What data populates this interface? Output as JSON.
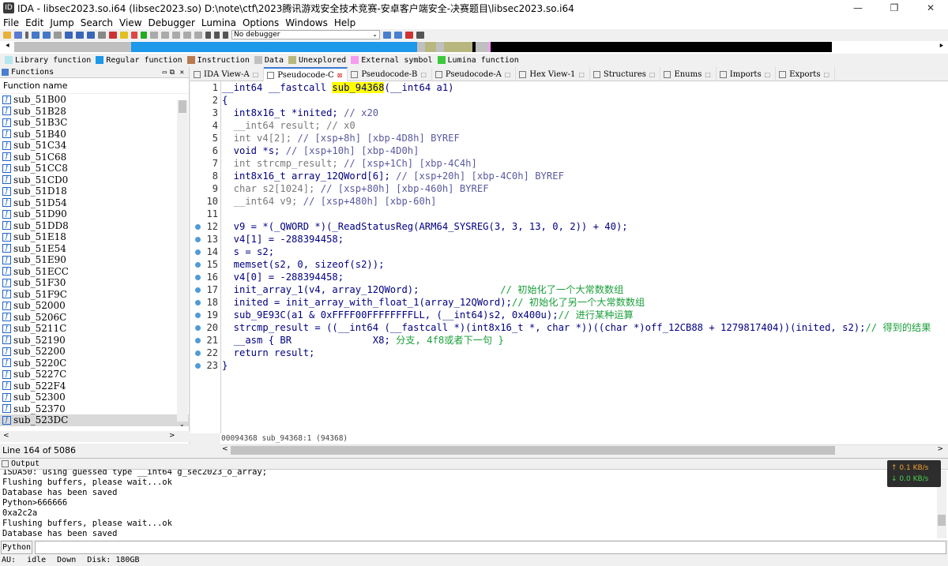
{
  "window": {
    "title": "IDA - libsec2023.so.i64 (libsec2023.so) D:\\note\\ctf\\2023腾讯游戏安全技术竞赛-安卓客户端安全-决赛题目\\libsec2023.so.i64",
    "minimize": "—",
    "maximize": "❐",
    "close": "✕"
  },
  "menu": [
    "File",
    "Edit",
    "Jump",
    "Search",
    "View",
    "Debugger",
    "Lumina",
    "Options",
    "Windows",
    "Help"
  ],
  "toolbar": {
    "debugger": "No debugger"
  },
  "legend": [
    {
      "label": "Library function",
      "color": "#b4e6f0"
    },
    {
      "label": "Regular function",
      "color": "#1e98e8"
    },
    {
      "label": "Instruction",
      "color": "#b87a50"
    },
    {
      "label": "Data",
      "color": "#c0c0c0"
    },
    {
      "label": "Unexplored",
      "color": "#b9b780"
    },
    {
      "label": "External symbol",
      "color": "#f49cf0"
    },
    {
      "label": "Lumina function",
      "color": "#3cc83c"
    }
  ],
  "functions": {
    "title": "Functions",
    "column": "Function name",
    "items": [
      "sub_51B00",
      "sub_51B28",
      "sub_51B3C",
      "sub_51B40",
      "sub_51C34",
      "sub_51C68",
      "sub_51CC8",
      "sub_51CD0",
      "sub_51D18",
      "sub_51D54",
      "sub_51D90",
      "sub_51DD8",
      "sub_51E18",
      "sub_51E54",
      "sub_51E90",
      "sub_51ECC",
      "sub_51F30",
      "sub_51F9C",
      "sub_52000",
      "sub_5206C",
      "sub_5211C",
      "sub_52190",
      "sub_52200",
      "sub_5220C",
      "sub_5227C",
      "sub_522F4",
      "sub_52300",
      "sub_52370",
      "sub_523DC"
    ],
    "line_count": "Line 164 of 5086"
  },
  "tabs": [
    "IDA View-A",
    "Pseudocode-C",
    "Pseudocode-B",
    "Pseudocode-A",
    "Hex View-1",
    "Structures",
    "Enums",
    "Imports",
    "Exports"
  ],
  "code": {
    "line_numbers": [
      "1",
      "2",
      "3",
      "4",
      "5",
      "6",
      "7",
      "8",
      "9",
      "10",
      "11",
      "12",
      "13",
      "14",
      "15",
      "16",
      "17",
      "18",
      "19",
      "20",
      "21",
      "22",
      "23"
    ],
    "l1_pre": "__int64 __fastcall ",
    "l1_fn": "sub_94368",
    "l1_post": "(__int64 a1)",
    "l2": "{",
    "l3a": "  int8x16_t *inited; ",
    "l3b": "// x20",
    "l4": "  __int64 result; // x0",
    "l5a": "  int v4[2]; ",
    "l5b": "// [xsp+8h] [xbp-4D8h] BYREF",
    "l6a": "  void *s; ",
    "l6b": "// [xsp+10h] [xbp-4D0h]",
    "l7a": "  int strcmp_result; ",
    "l7b": "// [xsp+1Ch] [xbp-4C4h]",
    "l8a": "  int8x16_t array_12QWord[6]; ",
    "l8b": "// [xsp+20h] [xbp-4C0h] BYREF",
    "l9a": "  char s2[1024]; ",
    "l9b": "// [xsp+80h] [xbp-460h] BYREF",
    "l10a": "  __int64 v9; ",
    "l10b": "// [xsp+480h] [xbp-60h]",
    "l11": "",
    "l12": "  v9 = *(_QWORD *)(_ReadStatusReg(ARM64_SYSREG(3, 3, 13, 0, 2)) + 40);",
    "l13": "  v4[1] = -288394458;",
    "l14": "  s = s2;",
    "l15": "  memset(s2, 0, sizeof(s2));",
    "l16": "  v4[0] = -288394458;",
    "l17a": "  init_array_1(v4, array_12QWord);",
    "l17b": "              // 初始化了一个大常数数组",
    "l18a": "  inited = init_array_with_float_1(array_12QWord);",
    "l18b": "// 初始化了另一个大常数数组",
    "l19a": "  sub_9E93C(a1 & 0xFFFF00FFFFFFFFLL, (__int64)s2, 0x400u);",
    "l19b": "// 进行某种运算",
    "l20a": "  strcmp_result = ((__int64 (__fastcall *)(int8x16_t *, char *))((char *)off_12CB88 + 1279817404))(inited, s2);",
    "l20b": "// 得到的结果",
    "l21a": "  __asm { BR              X8; ",
    "l21b": "分支, 4f8或者下一句 }",
    "l22": "  return result;",
    "l23": "}"
  },
  "status_line": "00094368 sub_94368:1 (94368)",
  "output": {
    "title": "Output",
    "lines": [
      "1SDA50: using guessed type __int64 g_sec2023_o_array;",
      "Flushing buffers, please wait...ok",
      "Database has been saved",
      "Python>666666",
      "0xa2c2a",
      "Flushing buffers, please wait...ok",
      "Database has been saved"
    ]
  },
  "python_button": "Python",
  "statusbar": {
    "au": "AU:",
    "state": "idle",
    "dir": "Down",
    "disk": "Disk: 180GB"
  },
  "network": {
    "up": "↑ 0.1 KB/s",
    "down": "↓ 0.0 KB/s"
  }
}
